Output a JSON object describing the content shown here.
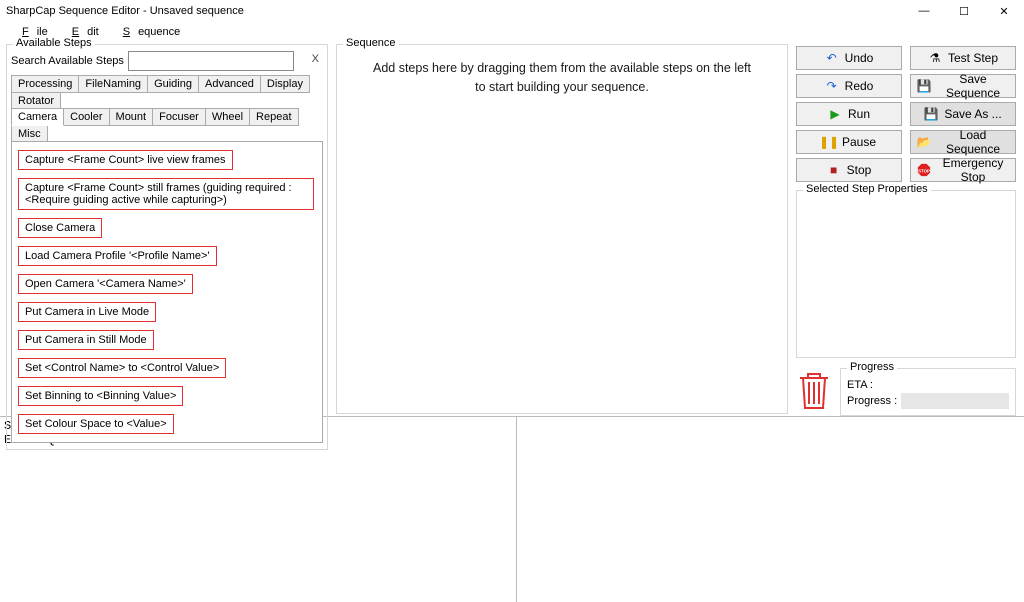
{
  "title": "SharpCap Sequence Editor - Unsaved sequence",
  "menu": {
    "file": "File",
    "edit": "Edit",
    "sequence": "Sequence"
  },
  "available": {
    "legend": "Available Steps",
    "search_label": "Search Available Steps",
    "search_value": "",
    "clear": "X",
    "tabs_row1": [
      "Processing",
      "FileNaming",
      "Guiding",
      "Advanced",
      "Display",
      "Rotator"
    ],
    "tabs_row2": [
      "Camera",
      "Cooler",
      "Mount",
      "Focuser",
      "Wheel",
      "Repeat",
      "Misc"
    ],
    "active_tab": "Camera",
    "steps": [
      "Capture <Frame Count> live view frames",
      "Capture <Frame Count> still frames (guiding required : <Require guiding active while capturing>)",
      "Close Camera",
      "Load Camera Profile '<Profile Name>'",
      "Open Camera '<Camera Name>'",
      "Put Camera in Live Mode",
      "Put Camera in Still Mode",
      "Set <Control Name> to <Control Value>",
      "Set Binning to <Binning Value>",
      "Set Colour Space to <Value>"
    ]
  },
  "sequence": {
    "legend": "Sequence",
    "placeholder": "Add steps here by dragging them from the available steps on the left to start building your sequence."
  },
  "buttons": {
    "undo": "Undo",
    "test": "Test Step",
    "redo": "Redo",
    "save_seq": "Save Sequence",
    "run": "Run",
    "save_as": "Save As ...",
    "pause": "Pause",
    "load_seq": "Load Sequence",
    "stop": "Stop",
    "estop": "Emergency Stop"
  },
  "selected": {
    "legend": "Selected Step Properties"
  },
  "progress": {
    "legend": "Progress",
    "eta_label": "ETA :",
    "progress_label": "Progress :"
  },
  "code": "SEQUENCE\nEND SEQUENCE"
}
